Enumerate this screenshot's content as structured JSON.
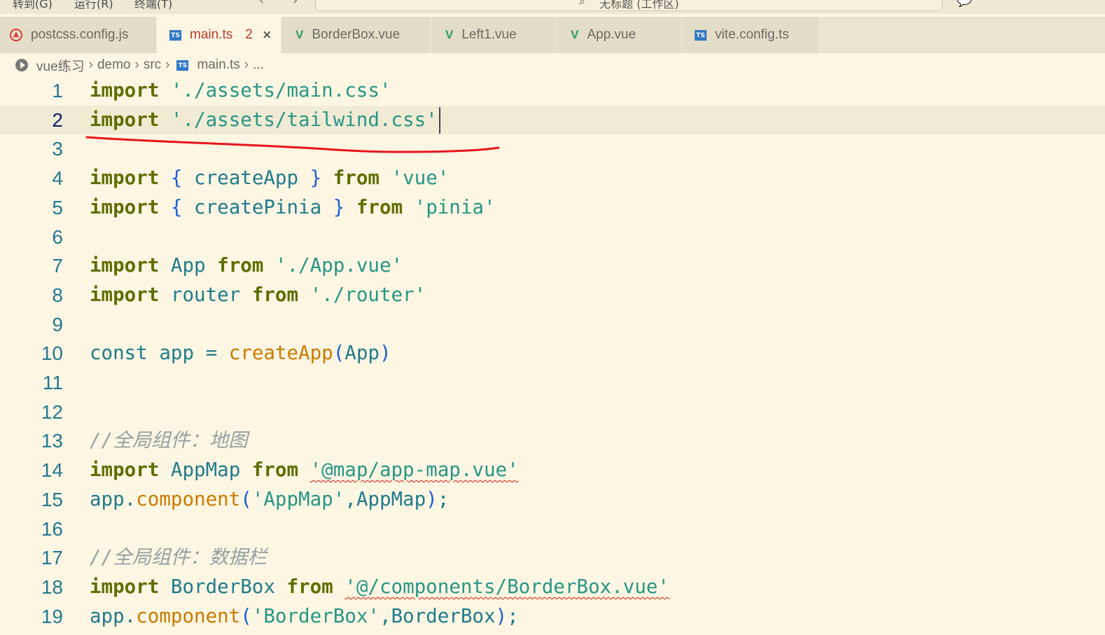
{
  "menubar": {
    "items": [
      "转到(G)",
      "运行(R)",
      "终端(T)"
    ],
    "search_text": "无标题 (工作区)"
  },
  "tabs": [
    {
      "label": "postcss.config.js",
      "icon": "postcss-icon"
    },
    {
      "label": "main.ts",
      "icon": "typescript-icon",
      "badge": "2",
      "active": true
    },
    {
      "label": "BorderBox.vue",
      "icon": "vue-icon"
    },
    {
      "label": "Left1.vue",
      "icon": "vue-icon"
    },
    {
      "label": "App.vue",
      "icon": "vue-icon"
    },
    {
      "label": "vite.config.ts",
      "icon": "typescript-icon"
    }
  ],
  "breadcrumb": [
    "vue练习",
    "demo",
    "src",
    "main.ts",
    "..."
  ],
  "editor": {
    "current_line": 2,
    "line_numbers": [
      "1",
      "2",
      "3",
      "4",
      "5",
      "6",
      "7",
      "8",
      "9",
      "10",
      "11",
      "12",
      "13",
      "14",
      "15",
      "16",
      "17",
      "18",
      "19"
    ],
    "lines": [
      [
        {
          "t": "import",
          "c": "kw"
        },
        {
          "t": " "
        },
        {
          "t": "'./assets/main.css'",
          "c": "str"
        }
      ],
      [
        {
          "t": "import",
          "c": "kw"
        },
        {
          "t": " "
        },
        {
          "t": "'./assets/tailwind.css'",
          "c": "str"
        }
      ],
      [],
      [
        {
          "t": "import",
          "c": "kw"
        },
        {
          "t": " "
        },
        {
          "t": "{",
          "c": "brace"
        },
        {
          "t": " "
        },
        {
          "t": "createApp",
          "c": "ident"
        },
        {
          "t": " "
        },
        {
          "t": "}",
          "c": "brace"
        },
        {
          "t": " "
        },
        {
          "t": "from",
          "c": "kw"
        },
        {
          "t": " "
        },
        {
          "t": "'vue'",
          "c": "str"
        }
      ],
      [
        {
          "t": "import",
          "c": "kw"
        },
        {
          "t": " "
        },
        {
          "t": "{",
          "c": "brace"
        },
        {
          "t": " "
        },
        {
          "t": "createPinia",
          "c": "ident"
        },
        {
          "t": " "
        },
        {
          "t": "}",
          "c": "brace"
        },
        {
          "t": " "
        },
        {
          "t": "from",
          "c": "kw"
        },
        {
          "t": " "
        },
        {
          "t": "'pinia'",
          "c": "str"
        }
      ],
      [],
      [
        {
          "t": "import",
          "c": "kw"
        },
        {
          "t": " "
        },
        {
          "t": "App",
          "c": "ident"
        },
        {
          "t": " "
        },
        {
          "t": "from",
          "c": "kw"
        },
        {
          "t": " "
        },
        {
          "t": "'./App.vue'",
          "c": "str"
        }
      ],
      [
        {
          "t": "import",
          "c": "kw"
        },
        {
          "t": " "
        },
        {
          "t": "router",
          "c": "ident"
        },
        {
          "t": " "
        },
        {
          "t": "from",
          "c": "kw"
        },
        {
          "t": " "
        },
        {
          "t": "'./router'",
          "c": "str"
        }
      ],
      [],
      [
        {
          "t": "const",
          "c": "ident"
        },
        {
          "t": " "
        },
        {
          "t": "app",
          "c": "ident"
        },
        {
          "t": " "
        },
        {
          "t": "=",
          "c": "ident"
        },
        {
          "t": " "
        },
        {
          "t": "createApp",
          "c": "fn"
        },
        {
          "t": "(",
          "c": "brace"
        },
        {
          "t": "App",
          "c": "ident"
        },
        {
          "t": ")",
          "c": "brace"
        }
      ],
      [],
      [],
      [
        {
          "t": "//全局组件：地图",
          "c": "cmt"
        }
      ],
      [
        {
          "t": "import",
          "c": "kw"
        },
        {
          "t": " "
        },
        {
          "t": "AppMap",
          "c": "ident"
        },
        {
          "t": " "
        },
        {
          "t": "from",
          "c": "kw"
        },
        {
          "t": " "
        },
        {
          "t": "'@map/app-map.vue'",
          "c": "str",
          "err": true
        }
      ],
      [
        {
          "t": "app",
          "c": "ident"
        },
        {
          "t": ".",
          "c": "ident"
        },
        {
          "t": "component",
          "c": "fn"
        },
        {
          "t": "(",
          "c": "brace"
        },
        {
          "t": "'AppMap'",
          "c": "str"
        },
        {
          "t": ",",
          "c": "ident"
        },
        {
          "t": "AppMap",
          "c": "ident"
        },
        {
          "t": ")",
          "c": "brace"
        },
        {
          "t": ";",
          "c": "ident"
        }
      ],
      [],
      [
        {
          "t": "//全局组件：数据栏",
          "c": "cmt"
        }
      ],
      [
        {
          "t": "import",
          "c": "kw"
        },
        {
          "t": " "
        },
        {
          "t": "BorderBox",
          "c": "ident"
        },
        {
          "t": " "
        },
        {
          "t": "from",
          "c": "kw"
        },
        {
          "t": " "
        },
        {
          "t": "'@/components/BorderBox.vue'",
          "c": "str",
          "err": true
        }
      ],
      [
        {
          "t": "app",
          "c": "ident"
        },
        {
          "t": ".",
          "c": "ident"
        },
        {
          "t": "component",
          "c": "fn"
        },
        {
          "t": "(",
          "c": "brace"
        },
        {
          "t": "'BorderBox'",
          "c": "str"
        },
        {
          "t": ",",
          "c": "ident"
        },
        {
          "t": "BorderBox",
          "c": "ident"
        },
        {
          "t": ")",
          "c": "brace"
        },
        {
          "t": ";",
          "c": "ident"
        }
      ]
    ]
  }
}
